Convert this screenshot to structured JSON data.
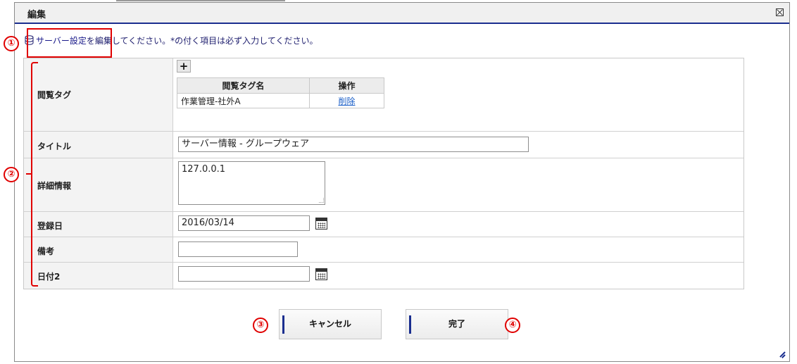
{
  "dialog": {
    "title": "編集",
    "info_prefix": "サーバー設定",
    "info_suffix": "を編集してください。*の付く項目は必ず入力してください。"
  },
  "form": {
    "tags": {
      "label": "閲覧タグ",
      "add_button": "+",
      "table": {
        "headers": [
          "閲覧タグ名",
          "操作"
        ],
        "rows": [
          {
            "name": "作業管理-社外A",
            "action": "削除"
          }
        ]
      }
    },
    "title": {
      "label": "タイトル",
      "value": "サーバー情報 - グループウェア"
    },
    "detail": {
      "label": "詳細情報",
      "value": "127.0.0.1"
    },
    "registered": {
      "label": "登録日",
      "value": "2016/03/14"
    },
    "note": {
      "label": "備考",
      "value": ""
    },
    "date2": {
      "label": "日付2",
      "value": ""
    }
  },
  "buttons": {
    "cancel": "キャンセル",
    "done": "完了"
  },
  "annotations": {
    "m1": "①",
    "m2": "②",
    "m3": "③",
    "m4": "④",
    "color": "#e00000"
  },
  "colors": {
    "accent": "#1a2e8f",
    "link": "#1a5ec7"
  }
}
